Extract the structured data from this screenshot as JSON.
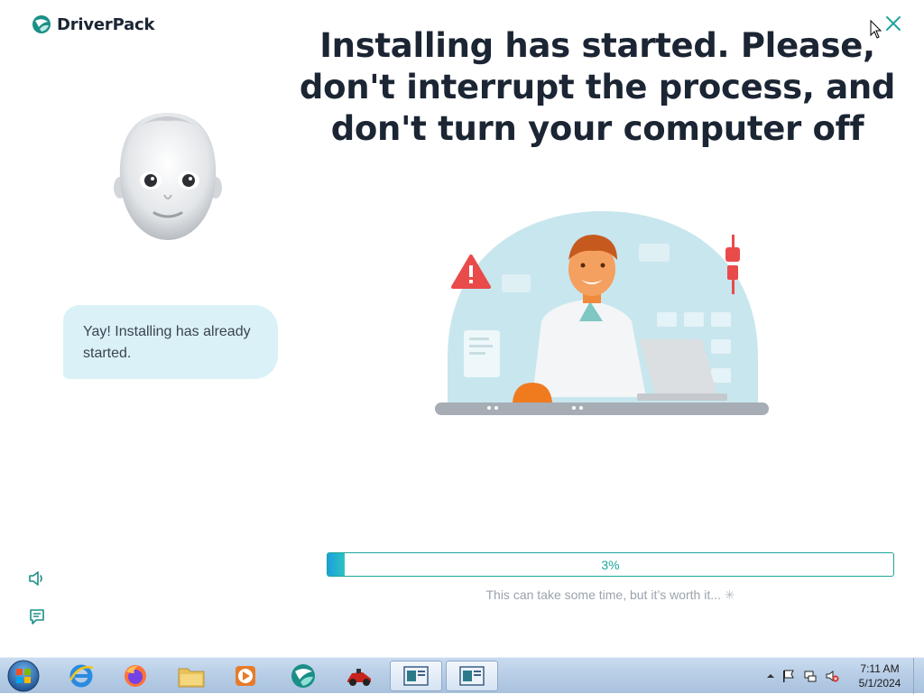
{
  "app": {
    "brand": "DriverPack",
    "headline_lines": [
      "Installing has started. Please,",
      "don't interrupt the process, and",
      "don't turn your computer off"
    ],
    "assistant_message": "Yay! Installing has already started.",
    "progress": {
      "percent": 3,
      "label": "3%",
      "hint": "This can take some time, but it’s worth it..."
    },
    "colors": {
      "accent": "#1ea69a",
      "progress_start": "#1a9fe0",
      "bubble_bg": "#dbf1f8",
      "headline": "#1b2533"
    },
    "icons": {
      "close": "close-icon",
      "sound": "speaker-icon",
      "chat": "chat-icon"
    }
  },
  "taskbar": {
    "apps": [
      {
        "name": "internet-explorer"
      },
      {
        "name": "firefox"
      },
      {
        "name": "file-explorer"
      },
      {
        "name": "media-player"
      },
      {
        "name": "driverpack"
      },
      {
        "name": "game"
      },
      {
        "name": "window-1",
        "active": true
      },
      {
        "name": "window-2",
        "active": true
      }
    ],
    "clock_time": "7:11 AM",
    "clock_date": "5/1/2024"
  }
}
